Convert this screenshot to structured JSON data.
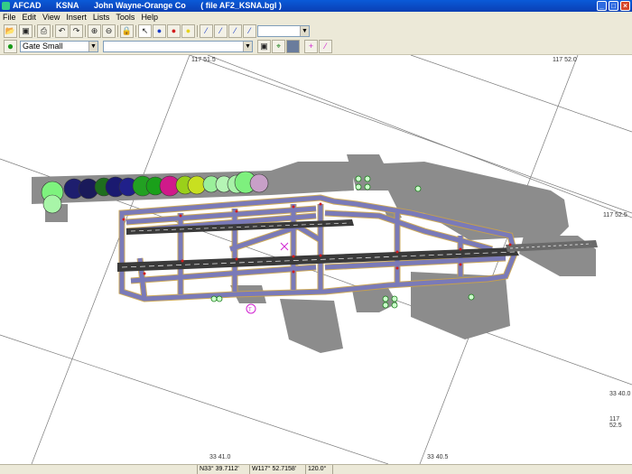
{
  "window": {
    "app": "AFCAD",
    "icao": "KSNA",
    "airport_name": "John Wayne-Orange Co",
    "file": "( file AF2_KSNA.bgl )",
    "minimize": "_",
    "maximize": "□",
    "close": "×"
  },
  "menu": [
    "File",
    "Edit",
    "View",
    "Insert",
    "Lists",
    "Tools",
    "Help"
  ],
  "toolbar2": {
    "gate_type": "Gate Small",
    "second_combo": "",
    "zoom_combo": ""
  },
  "map": {
    "colors": {
      "background": "#ffffff",
      "apron": "#8c8c8c",
      "runway": "#3a3a3a",
      "taxiway": "#7a7ab8",
      "taxi_edge": "#c9a24a",
      "grid": "#7a7a7a"
    },
    "coord_labels": {
      "top_left": "117 51.5",
      "top_right": "117 52.0",
      "right_mid": "117 52.5",
      "right_lower": "33 40.0",
      "right_bottom": "117 52.5",
      "bottom_left": "33 41.0",
      "bottom_right": "33 40.5"
    }
  },
  "status": {
    "lat": "N33° 39.7112'",
    "lon": "W117° 52.7158'",
    "heading": "120.0°"
  }
}
